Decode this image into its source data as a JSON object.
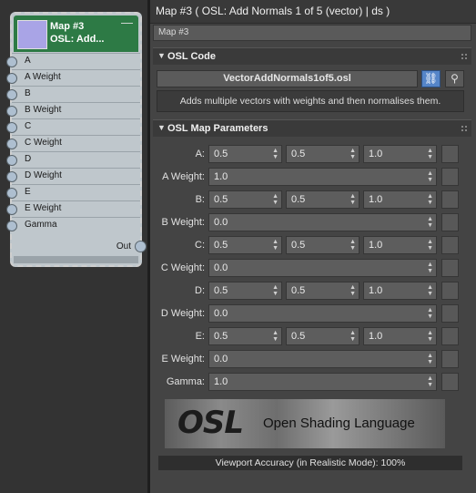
{
  "node": {
    "title_line1": "Map #3",
    "title_line2": "OSL: Add...",
    "minimize": "—",
    "swatch_color": "#a9a4e6",
    "sockets": [
      "A",
      "A Weight",
      "B",
      "B Weight",
      "C",
      "C Weight",
      "D",
      "D Weight",
      "E",
      "E Weight",
      "Gamma"
    ],
    "output_label": "Out"
  },
  "panel": {
    "title": "Map #3  ( OSL: Add Normals 1 of 5 (vector) | ds )",
    "name_value": "Map #3",
    "osl_code": {
      "header": "OSL Code",
      "arrow": "▼",
      "file_name": "VectorAddNormals1of5.osl",
      "link_icon": "⛓",
      "search_icon": "⚲",
      "description": "Adds multiple vectors with weights and then normalises them."
    },
    "params": {
      "header": "OSL Map Parameters",
      "arrow": "▼",
      "rows": [
        {
          "label": "A:",
          "values": [
            "0.5",
            "0.5",
            "1.0"
          ]
        },
        {
          "label": "A Weight:",
          "values": [
            "1.0"
          ]
        },
        {
          "label": "B:",
          "values": [
            "0.5",
            "0.5",
            "1.0"
          ]
        },
        {
          "label": "B Weight:",
          "values": [
            "0.0"
          ]
        },
        {
          "label": "C:",
          "values": [
            "0.5",
            "0.5",
            "1.0"
          ]
        },
        {
          "label": "C Weight:",
          "values": [
            "0.0"
          ]
        },
        {
          "label": "D:",
          "values": [
            "0.5",
            "0.5",
            "1.0"
          ]
        },
        {
          "label": "D Weight:",
          "values": [
            "0.0"
          ]
        },
        {
          "label": "E:",
          "values": [
            "0.5",
            "0.5",
            "1.0"
          ]
        },
        {
          "label": "E Weight:",
          "values": [
            "0.0"
          ]
        },
        {
          "label": "Gamma:",
          "values": [
            "1.0"
          ]
        }
      ]
    },
    "logo": {
      "mark": "OSL",
      "text": "Open Shading Language"
    },
    "viewport_accuracy": "Viewport Accuracy (in Realistic Mode): 100%"
  }
}
